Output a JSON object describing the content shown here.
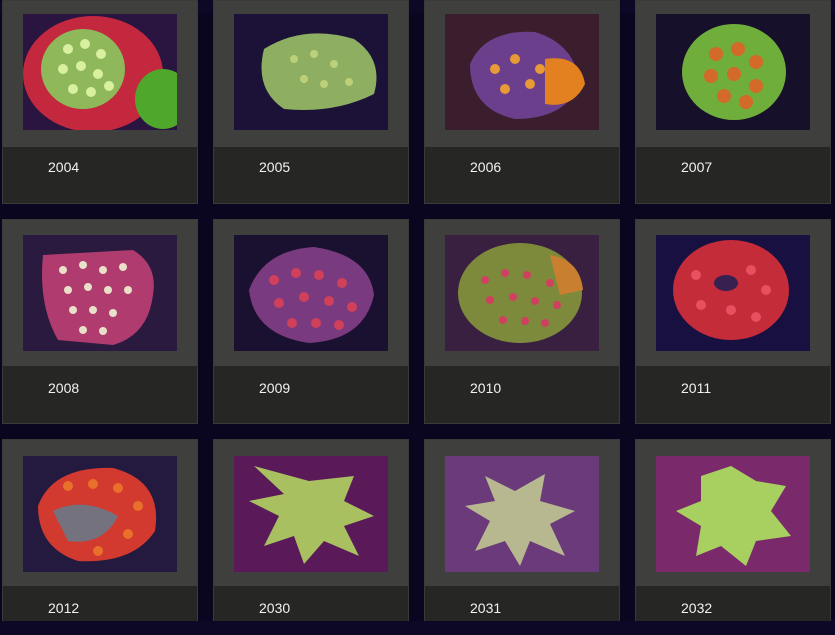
{
  "gallery": {
    "items": [
      {
        "id": "2004",
        "theme": "red-base-green-polyps"
      },
      {
        "id": "2005",
        "theme": "green-mat"
      },
      {
        "id": "2006",
        "theme": "purple-orange"
      },
      {
        "id": "2007",
        "theme": "green-orange"
      },
      {
        "id": "2008",
        "theme": "pink-white"
      },
      {
        "id": "2009",
        "theme": "purple-red"
      },
      {
        "id": "2010",
        "theme": "green-brown"
      },
      {
        "id": "2011",
        "theme": "red-dense"
      },
      {
        "id": "2012",
        "theme": "red-orange"
      },
      {
        "id": "2030",
        "theme": "green-star"
      },
      {
        "id": "2031",
        "theme": "pale-star"
      },
      {
        "id": "2032",
        "theme": "lime-star"
      }
    ]
  },
  "colors": {
    "page_bg": "#0a0620",
    "card_bg": "#262624",
    "frame_bg": "#3f3f3d",
    "label_text": "#f2f2f2"
  }
}
